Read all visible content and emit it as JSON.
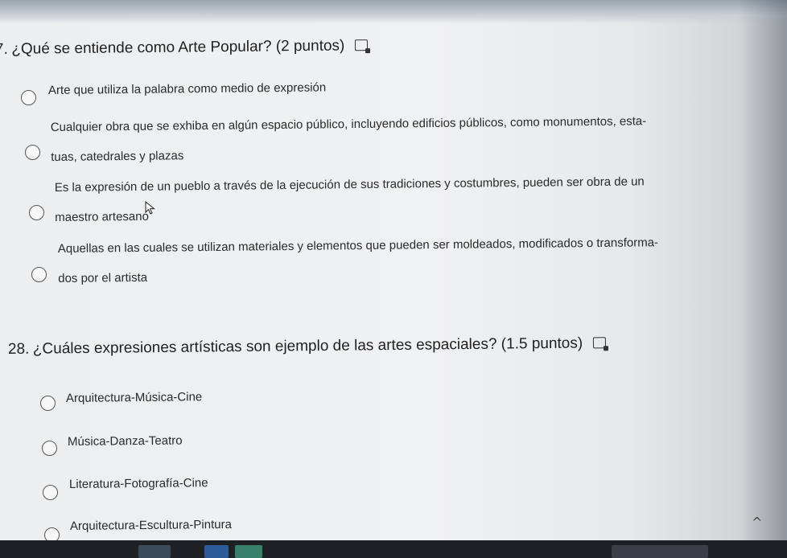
{
  "questions": [
    {
      "number": "7.",
      "text": "¿Qué se entiende como Arte Popular? (2 puntos)",
      "options": [
        {
          "lines": [
            "Arte que utiliza la palabra como medio de expresión"
          ]
        },
        {
          "lines": [
            "Cualquier obra que se exhiba en algún espacio público, incluyendo edificios públicos, como monumentos, esta-",
            "tuas, catedrales y plazas"
          ]
        },
        {
          "lines": [
            "Es la expresión de un pueblo a través de la ejecución de sus tradiciones y costumbres, pueden ser obra de un",
            "maestro artesano"
          ]
        },
        {
          "lines": [
            "Aquellas en las cuales se utilizan materiales y elementos que pueden ser moldeados, modificados o transforma-",
            "dos por el artista"
          ]
        }
      ]
    },
    {
      "number": "28.",
      "text": "¿Cuáles expresiones artísticas son ejemplo de las artes espaciales? (1.5 puntos)",
      "options": [
        {
          "lines": [
            "Arquitectura-Música-Cine"
          ]
        },
        {
          "lines": [
            "Música-Danza-Teatro"
          ]
        },
        {
          "lines": [
            "Literatura-Fotografía-Cine"
          ]
        },
        {
          "lines": [
            "Arquitectura-Escultura-Pintura"
          ]
        }
      ]
    }
  ],
  "icons": {
    "question_media": "image-icon",
    "cursor": "mouse-pointer-icon",
    "tray_chevron": "chevron-up-icon"
  },
  "colors": {
    "page_bg": "#eceef0",
    "text": "#1f1f1f",
    "radio_border": "#555555",
    "taskbar": "#1d2126"
  },
  "taskbar": {
    "tray_chevron_glyph": "^"
  }
}
